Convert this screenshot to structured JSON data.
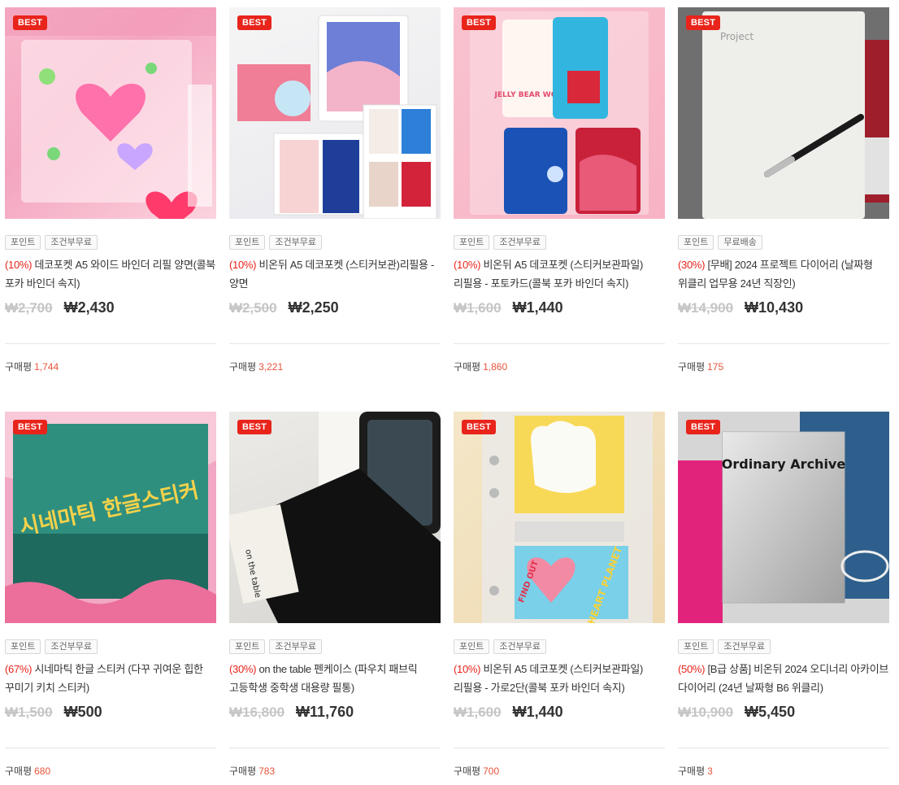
{
  "products": [
    {
      "best": "BEST",
      "tags": [
        "포인트",
        "조건부무료"
      ],
      "discount": "(10%)",
      "name": "데코포켓 A5 와이드 바인더 리필 양면(콜북 포카 바인더 속지)",
      "orig": "₩2,700",
      "sale": "₩2,430",
      "review_label": "구매평",
      "review_count": "1,744"
    },
    {
      "best": "BEST",
      "tags": [
        "포인트",
        "조건부무료"
      ],
      "discount": "(10%)",
      "name": "비온뒤 A5 데코포켓 (스티커보관)리필용 - 양면",
      "orig": "₩2,500",
      "sale": "₩2,250",
      "review_label": "구매평",
      "review_count": "3,221"
    },
    {
      "best": "BEST",
      "tags": [
        "포인트",
        "조건부무료"
      ],
      "discount": "(10%)",
      "name": "비온뒤 A5 데코포켓 (스티커보관파일) 리필용 - 포토카드(콜북 포카 바인더 속지)",
      "orig": "₩1,600",
      "sale": "₩1,440",
      "review_label": "구매평",
      "review_count": "1,860"
    },
    {
      "best": "BEST",
      "tags": [
        "포인트",
        "무료배송"
      ],
      "discount": "(30%)",
      "name": "[무배] 2024 프로젝트 다이어리 (날짜형 위클리 업무용 24년 직장인)",
      "orig": "₩14,900",
      "sale": "₩10,430",
      "review_label": "구매평",
      "review_count": "175"
    },
    {
      "best": "BEST",
      "tags": [
        "포인트",
        "조건부무료"
      ],
      "discount": "(67%)",
      "name": "시네마틱 한글 스티커 (다꾸 귀여운 힙한 꾸미기 키치 스티커)",
      "orig": "₩1,500",
      "sale": "₩500",
      "review_label": "구매평",
      "review_count": "680"
    },
    {
      "best": "BEST",
      "tags": [
        "포인트",
        "조건부무료"
      ],
      "discount": "(30%)",
      "name": "on the table 펜케이스 (파우치 패브릭 고등학생 중학생 대용량 필통)",
      "orig": "₩16,800",
      "sale": "₩11,760",
      "review_label": "구매평",
      "review_count": "783"
    },
    {
      "best": "BEST",
      "tags": [
        "포인트",
        "조건부무료"
      ],
      "discount": "(10%)",
      "name": "비온뒤 A5 데코포켓 (스티커보관파일)리필용 - 가로2단(콜북 포카 바인더 속지)",
      "orig": "₩1,600",
      "sale": "₩1,440",
      "review_label": "구매평",
      "review_count": "700"
    },
    {
      "best": "BEST",
      "tags": [
        "포인트",
        "조건부무료"
      ],
      "discount": "(50%)",
      "name": "[B급 상품] 비온뒤 2024 오디너리 아카이브 다이어리 (24년 날짜형 B6 위클리)",
      "orig": "₩10,900",
      "sale": "₩5,450",
      "review_label": "구매평",
      "review_count": "3"
    }
  ],
  "photo_text": {
    "p3_card": "JELLY BEAR WORLD",
    "p4_cover": "Project",
    "p5_sticker": "시네마틱 한글스티커",
    "p6_label": "on the table",
    "p7_heart": "HEART PLANET",
    "p7_findout": "FIND OUT",
    "p8_cover": "Ordinary Archive"
  }
}
